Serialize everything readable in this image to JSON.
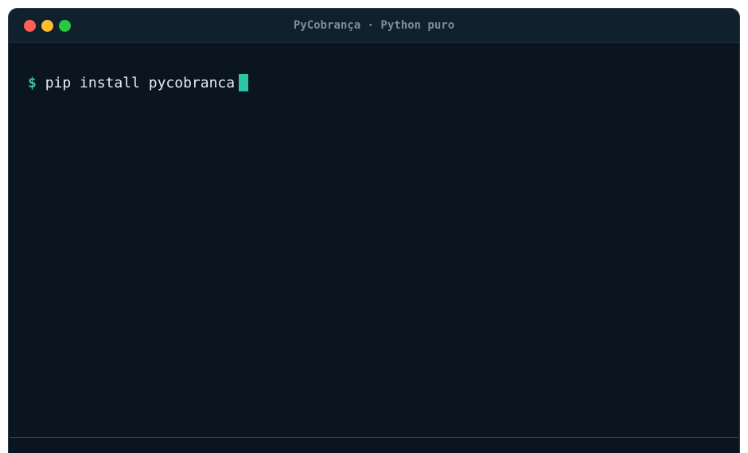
{
  "window": {
    "title": "PyCobrança · Python puro",
    "controls": [
      {
        "name": "close-button",
        "color": "#ff5f57"
      },
      {
        "name": "minimize-button",
        "color": "#febc2e"
      },
      {
        "name": "maximize-button",
        "color": "#28c840"
      }
    ]
  },
  "terminal": {
    "prompt_symbol": "$",
    "command": "pip install pycobranca"
  },
  "colors": {
    "background": "#0b151f",
    "titlebar": "#10202d",
    "title_text": "#7a8d9c",
    "prompt": "#3ac0a0",
    "command_text": "#e6edf2",
    "cursor": "#2ec4a8"
  }
}
